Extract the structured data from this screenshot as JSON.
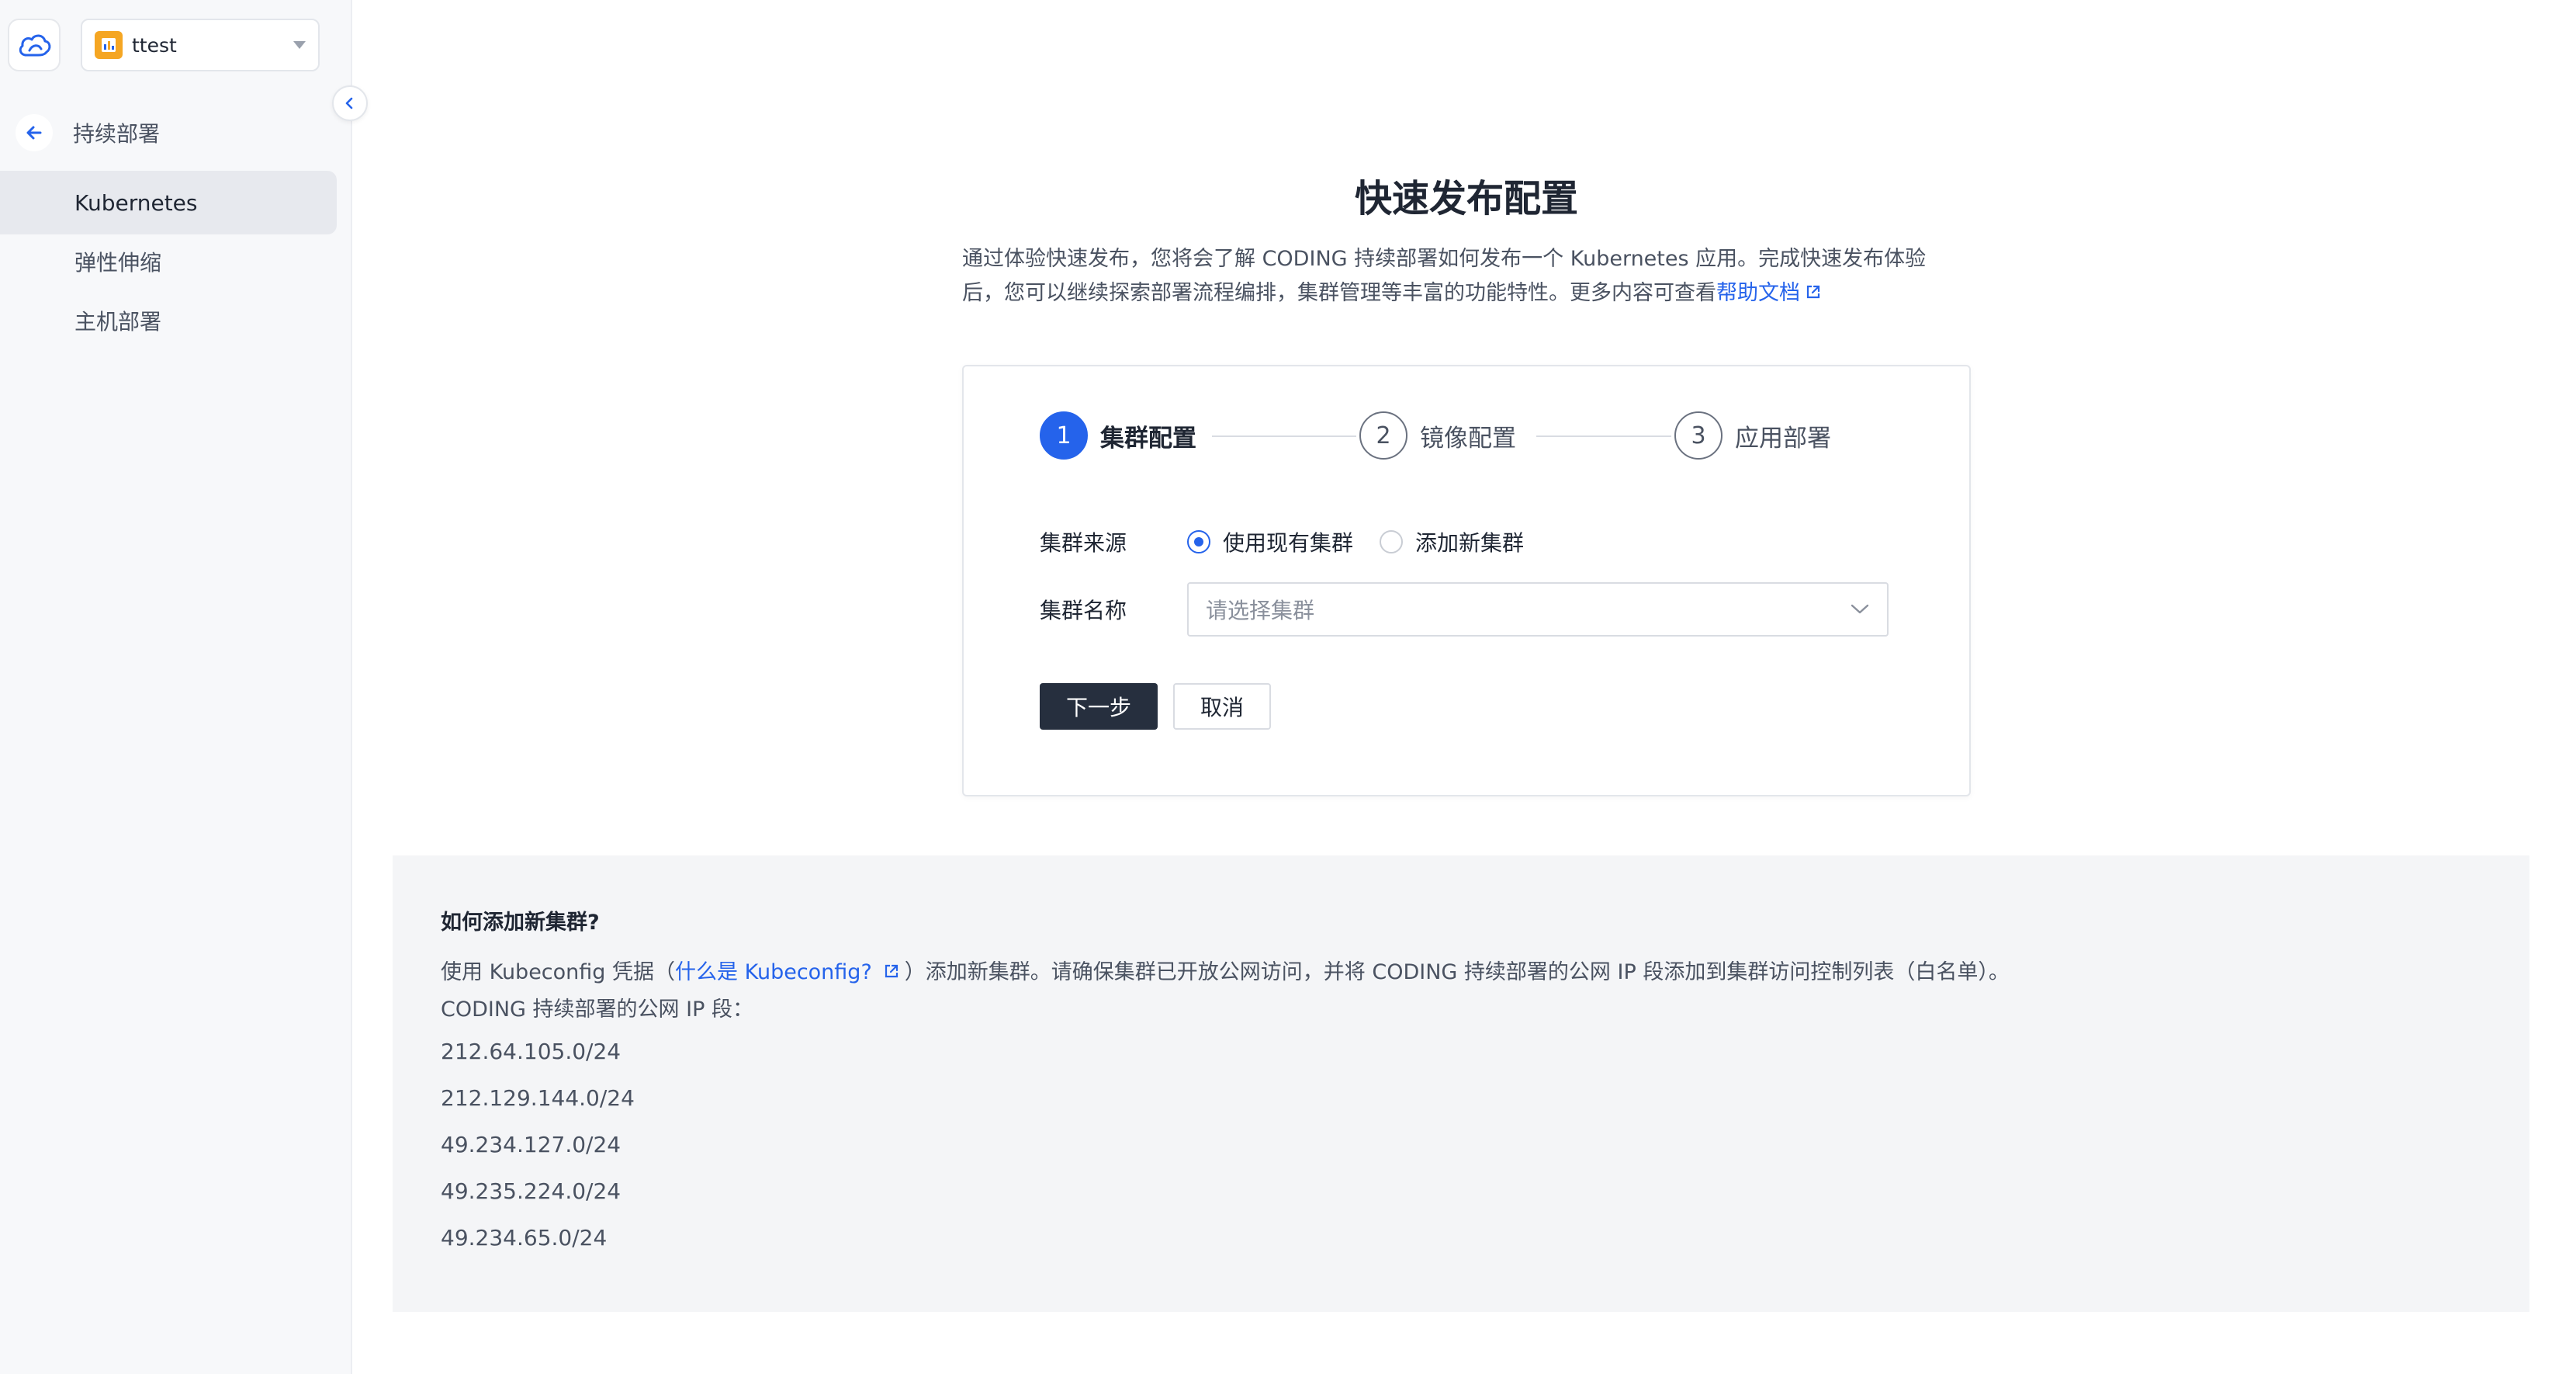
{
  "sidebar": {
    "project_name": "ttest",
    "back_label": "持续部署",
    "items": [
      {
        "label": "Kubernetes",
        "active": true
      },
      {
        "label": "弹性伸缩",
        "active": false
      },
      {
        "label": "主机部署",
        "active": false
      }
    ]
  },
  "main": {
    "title": "快速发布配置",
    "desc_line1": "通过体验快速发布，您将会了解 CODING 持续部署如何发布一个 Kubernetes 应用。完成快速发布体验",
    "desc_line2": "后，您可以继续探索部署流程编排，集群管理等丰富的功能特性。更多内容可查看",
    "help_link": "帮助文档"
  },
  "steps": [
    {
      "num": "1",
      "label": "集群配置",
      "active": true
    },
    {
      "num": "2",
      "label": "镜像配置",
      "active": false
    },
    {
      "num": "3",
      "label": "应用部署",
      "active": false
    }
  ],
  "form": {
    "source_label": "集群来源",
    "option_existing": "使用现有集群",
    "option_new": "添加新集群",
    "name_label": "集群名称",
    "name_placeholder": "请选择集群",
    "next_button": "下一步",
    "cancel_button": "取消"
  },
  "info": {
    "title": "如何添加新集群?",
    "line1_prefix": "使用 Kubeconfig 凭据（",
    "line1_link": "什么是 Kubeconfig?",
    "line1_suffix": "）添加新集群。请确保集群已开放公网访问，并将 CODING 持续部署的公网 IP 段添加到集群访问控制列表（白名单）。",
    "line2": "CODING 持续部署的公网 IP 段：",
    "ips": [
      "212.64.105.0/24",
      "212.129.144.0/24",
      "49.234.127.0/24",
      "49.235.224.0/24",
      "49.234.65.0/24"
    ]
  },
  "colors": {
    "accent": "#2563eb",
    "primary_button": "#262f3e"
  }
}
